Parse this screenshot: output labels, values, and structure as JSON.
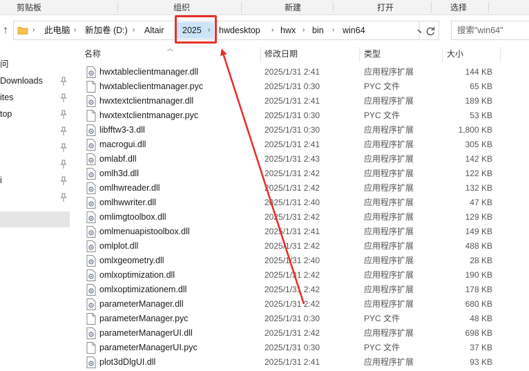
{
  "ribbon": {
    "groups": [
      "剪贴板",
      "组织",
      "新建",
      "打开",
      "选择"
    ]
  },
  "address": {
    "crumbs": [
      "此电脑",
      "新加卷 (D:)",
      "Altair",
      "2025",
      "hwdesktop",
      "hwx",
      "bin",
      "win64"
    ],
    "highlighted_crumb": "2025"
  },
  "search": {
    "placeholder": "搜索\"win64\""
  },
  "nav": {
    "items": [
      "问",
      "Downloads",
      "ites",
      "top",
      "",
      "",
      "",
      "i",
      ""
    ],
    "pinned_count": 8
  },
  "columns": {
    "name": "名称",
    "date": "修改日期",
    "type": "类型",
    "size": "大小"
  },
  "files": [
    {
      "name": "hwxtableclientmanager.dll",
      "date": "2025/1/31 2:41",
      "type": "应用程序扩展",
      "size": "144 KB",
      "icon": "dll-icon"
    },
    {
      "name": "hwxtableclientmanager.pyc",
      "date": "2025/1/31 0:30",
      "type": "PYC 文件",
      "size": "65 KB",
      "icon": "file-icon"
    },
    {
      "name": "hwxtextclientmanager.dll",
      "date": "2025/1/31 2:41",
      "type": "应用程序扩展",
      "size": "189 KB",
      "icon": "dll-icon"
    },
    {
      "name": "hwxtextclientmanager.pyc",
      "date": "2025/1/31 0:30",
      "type": "PYC 文件",
      "size": "53 KB",
      "icon": "file-icon"
    },
    {
      "name": "libfftw3-3.dll",
      "date": "2025/1/31 0:30",
      "type": "应用程序扩展",
      "size": "1,800 KB",
      "icon": "dll-icon"
    },
    {
      "name": "macrogui.dll",
      "date": "2025/1/31 2:41",
      "type": "应用程序扩展",
      "size": "305 KB",
      "icon": "dll-icon"
    },
    {
      "name": "omlabf.dll",
      "date": "2025/1/31 2:43",
      "type": "应用程序扩展",
      "size": "142 KB",
      "icon": "dll-icon"
    },
    {
      "name": "omlh3d.dll",
      "date": "2025/1/31 2:42",
      "type": "应用程序扩展",
      "size": "122 KB",
      "icon": "dll-icon"
    },
    {
      "name": "omlhwreader.dll",
      "date": "2025/1/31 2:42",
      "type": "应用程序扩展",
      "size": "132 KB",
      "icon": "dll-icon"
    },
    {
      "name": "omlhwwriter.dll",
      "date": "2025/1/31 2:40",
      "type": "应用程序扩展",
      "size": "47 KB",
      "icon": "dll-icon"
    },
    {
      "name": "omlimgtoolbox.dll",
      "date": "2025/1/31 2:42",
      "type": "应用程序扩展",
      "size": "129 KB",
      "icon": "dll-icon"
    },
    {
      "name": "omlmenuapistoolbox.dll",
      "date": "2025/1/31 2:41",
      "type": "应用程序扩展",
      "size": "149 KB",
      "icon": "dll-icon"
    },
    {
      "name": "omlplot.dll",
      "date": "2025/1/31 2:42",
      "type": "应用程序扩展",
      "size": "488 KB",
      "icon": "dll-icon"
    },
    {
      "name": "omlxgeometry.dll",
      "date": "2025/1/31 2:40",
      "type": "应用程序扩展",
      "size": "28 KB",
      "icon": "dll-icon"
    },
    {
      "name": "omlxoptimization.dll",
      "date": "2025/1/31 2:42",
      "type": "应用程序扩展",
      "size": "190 KB",
      "icon": "dll-icon"
    },
    {
      "name": "omlxoptimizationem.dll",
      "date": "2025/1/31 2:42",
      "type": "应用程序扩展",
      "size": "178 KB",
      "icon": "dll-icon"
    },
    {
      "name": "parameterManager.dll",
      "date": "2025/1/31 2:42",
      "type": "应用程序扩展",
      "size": "680 KB",
      "icon": "dll-icon"
    },
    {
      "name": "parameterManager.pyc",
      "date": "2025/1/31 0:30",
      "type": "PYC 文件",
      "size": "48 KB",
      "icon": "file-icon"
    },
    {
      "name": "parameterManagerUI.dll",
      "date": "2025/1/31 2:42",
      "type": "应用程序扩展",
      "size": "698 KB",
      "icon": "dll-icon"
    },
    {
      "name": "parameterManagerUI.pyc",
      "date": "2025/1/31 0:30",
      "type": "PYC 文件",
      "size": "37 KB",
      "icon": "file-icon"
    },
    {
      "name": "plot3dDlgUI.dll",
      "date": "2025/1/31 2:41",
      "type": "应用程序扩展",
      "size": "93 KB",
      "icon": "dll-icon"
    }
  ],
  "colors": {
    "annotation": "#e8302a",
    "crumb_highlight": "#cce4f7",
    "nav_selected": "#e5e5e5"
  }
}
